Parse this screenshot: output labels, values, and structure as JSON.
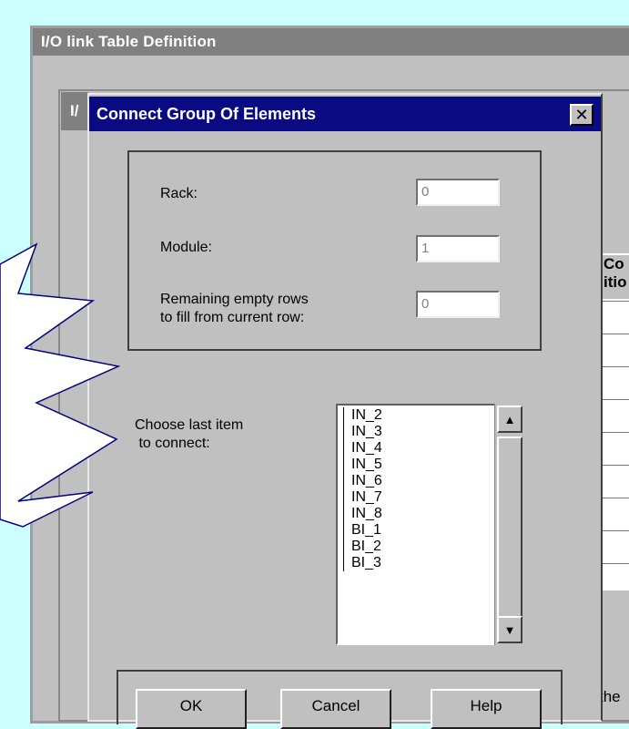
{
  "outer_window": {
    "title": "I/O link Table Definition"
  },
  "inner_window": {
    "title_fragment": "I/"
  },
  "dialog": {
    "title": "Connect Group Of Elements",
    "close_symbol": "✕",
    "rack": {
      "label": "Rack:",
      "value": "0"
    },
    "module": {
      "label": "Module:",
      "value": "1"
    },
    "remaining": {
      "label_line1": "Remaining empty rows",
      "label_line2": "to fill from current row:",
      "value": "0"
    },
    "choose_label_line1": "Choose last item",
    "choose_label_line2": " to connect:",
    "list_items": [
      "IN_2",
      "IN_3",
      "IN_4",
      "IN_5",
      "IN_6",
      "IN_7",
      "IN_8",
      "BI_1",
      "BI_2",
      "BI_3"
    ],
    "buttons": {
      "ok": "OK",
      "cancel": "Cancel",
      "help": "Help"
    }
  },
  "right_table": {
    "head_line1": "Co",
    "head_line2": "itio",
    "footer_fragment": "the"
  },
  "colors": {
    "background": "#ccffff",
    "title_bar": "#0a0a82",
    "window": "#c0c0c0",
    "callout_stroke": "#000080"
  }
}
